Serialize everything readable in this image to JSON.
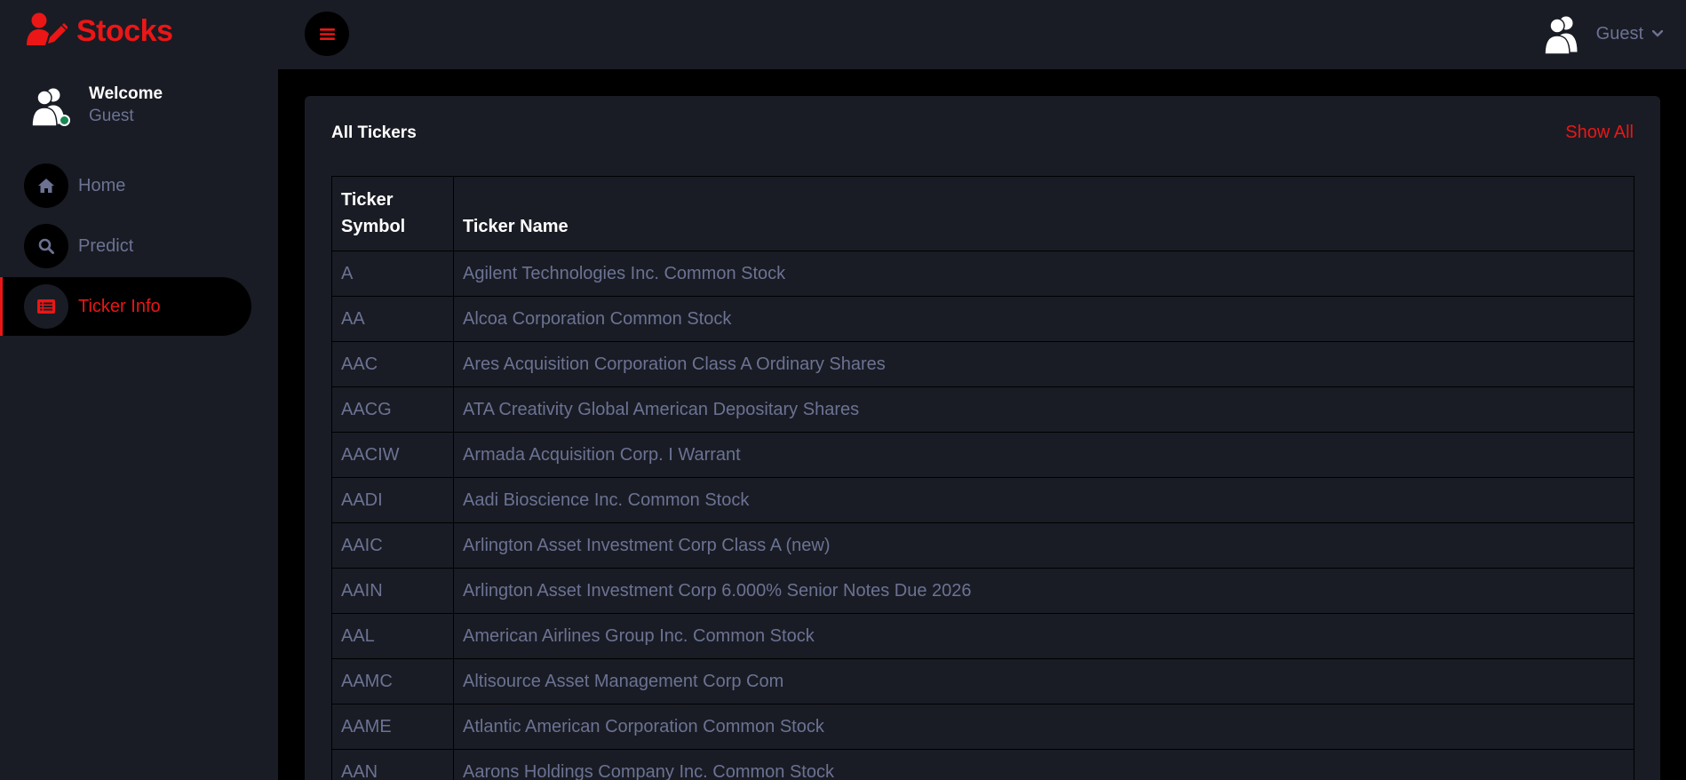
{
  "brand": {
    "name": "Stocks"
  },
  "sidebar": {
    "welcome": "Welcome",
    "user": "Guest",
    "items": [
      {
        "label": "Home",
        "icon": "home-icon",
        "active": false
      },
      {
        "label": "Predict",
        "icon": "search-icon",
        "active": false
      },
      {
        "label": "Ticker Info",
        "icon": "list-icon",
        "active": true
      }
    ]
  },
  "topbar": {
    "user_name": "Guest"
  },
  "card": {
    "title": "All Tickers",
    "show_all": "Show All",
    "columns": [
      "Ticker Symbol",
      "Ticker Name"
    ],
    "rows": [
      [
        "A",
        "Agilent Technologies Inc. Common Stock"
      ],
      [
        "AA",
        "Alcoa Corporation Common Stock"
      ],
      [
        "AAC",
        "Ares Acquisition Corporation Class A Ordinary Shares"
      ],
      [
        "AACG",
        "ATA Creativity Global American Depositary Shares"
      ],
      [
        "AACIW",
        "Armada Acquisition Corp. I Warrant"
      ],
      [
        "AADI",
        "Aadi Bioscience Inc. Common Stock"
      ],
      [
        "AAIC",
        "Arlington Asset Investment Corp Class A (new)"
      ],
      [
        "AAIN",
        "Arlington Asset Investment Corp 6.000% Senior Notes Due 2026"
      ],
      [
        "AAL",
        "American Airlines Group Inc. Common Stock"
      ],
      [
        "AAMC",
        "Altisource Asset Management Corp Com"
      ],
      [
        "AAME",
        "Atlantic American Corporation Common Stock"
      ],
      [
        "AAN",
        "Aarons Holdings Company Inc. Common Stock"
      ]
    ]
  },
  "colors": {
    "accent": "#eb1616",
    "background": "#191c24",
    "muted": "#6c7293",
    "black": "#000000"
  }
}
